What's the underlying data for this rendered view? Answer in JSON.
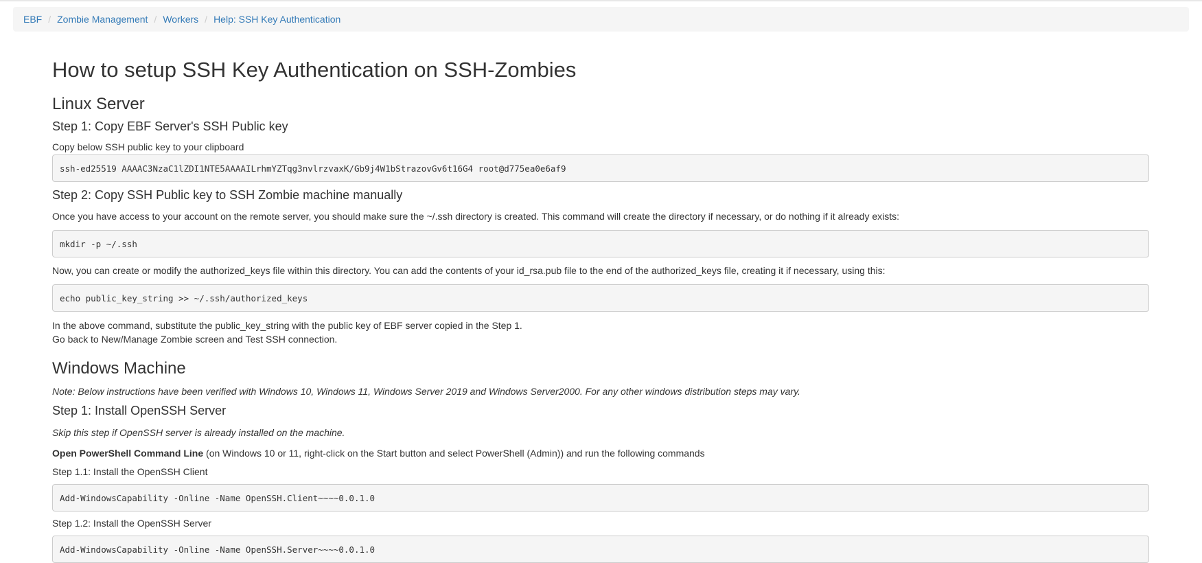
{
  "breadcrumb": {
    "items": [
      "EBF",
      "Zombie Management",
      "Workers",
      "Help: SSH Key Authentication"
    ],
    "separator": "/"
  },
  "page_title": "How to setup SSH Key Authentication on SSH-Zombies",
  "linux": {
    "heading": "Linux Server",
    "step1": {
      "heading": "Step 1: Copy EBF Server's SSH Public key",
      "text": "Copy below SSH public key to your clipboard",
      "code": "ssh-ed25519 AAAAC3NzaC1lZDI1NTE5AAAAILrhmYZTqg3nvlrzvaxK/Gb9j4W1bStrazovGv6t16G4 root@d775ea0e6af9"
    },
    "step2": {
      "heading": "Step 2: Copy SSH Public key to SSH Zombie machine manually",
      "text1": "Once you have access to your account on the remote server, you should make sure the ~/.ssh directory is created. This command will create the directory if necessary, or do nothing if it already exists:",
      "code1": "mkdir -p ~/.ssh",
      "text2": "Now, you can create or modify the authorized_keys file within this directory. You can add the contents of your id_rsa.pub file to the end of the authorized_keys file, creating it if necessary, using this:",
      "code2": "echo public_key_string >> ~/.ssh/authorized_keys",
      "text3": "In the above command, substitute the public_key_string with the public key of EBF server copied in the Step 1.",
      "text4": "Go back to New/Manage Zombie screen and Test SSH connection."
    }
  },
  "windows": {
    "heading": "Windows Machine",
    "note": "Note: Below instructions have been verified with Windows 10, Windows 11, Windows Server 2019 and Windows Server2000. For any other windows distribution steps may vary.",
    "step1": {
      "heading": "Step 1: Install OpenSSH Server",
      "skip_note": "Skip this step if OpenSSH server is already installed on the machine.",
      "ps_bold": "Open PowerShell Command Line",
      "ps_rest": " (on Windows 10 or 11, right-click on the Start button and select PowerShell (Admin)) and run the following commands",
      "step11_label": "Step 1.1: Install the OpenSSH Client",
      "step11_code": "Add-WindowsCapability -Online -Name OpenSSH.Client~~~~0.0.1.0",
      "step12_label": "Step 1.2: Install the OpenSSH Server",
      "step12_code": "Add-WindowsCapability -Online -Name OpenSSH.Server~~~~0.0.1.0"
    }
  },
  "colors": {
    "link": "#337ab7",
    "text": "#333333",
    "breadcrumb_bg": "#f5f5f5",
    "code_bg": "#f5f5f5",
    "code_border": "#cccccc"
  }
}
